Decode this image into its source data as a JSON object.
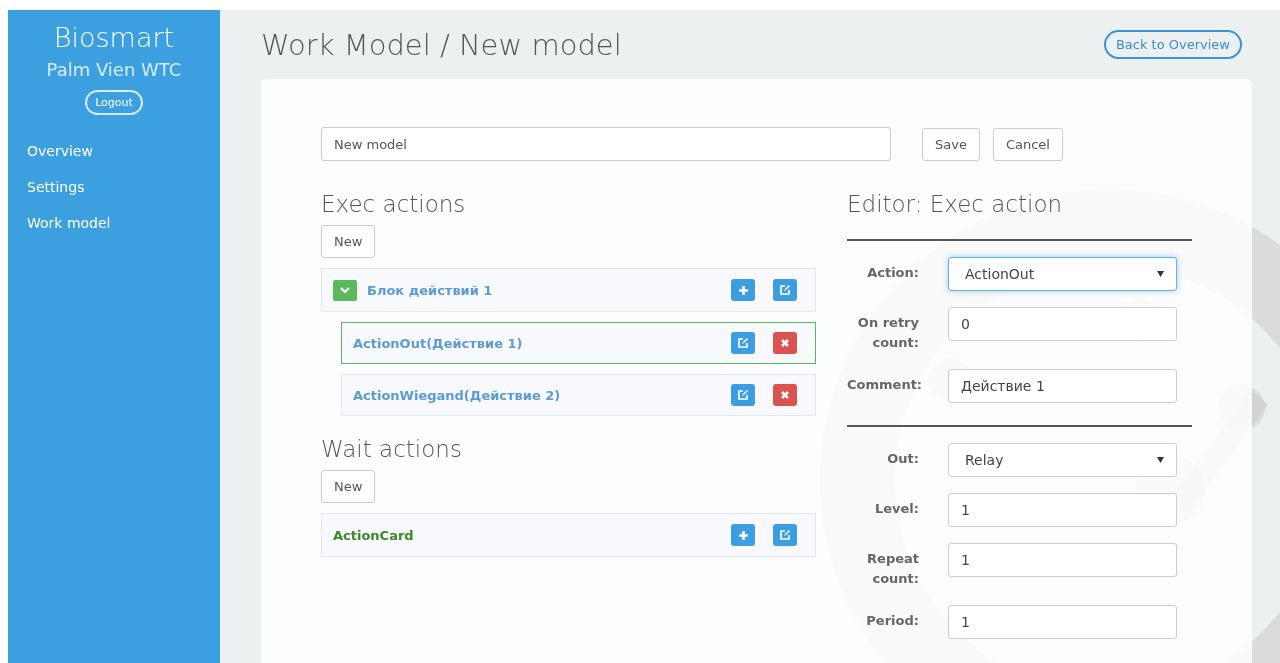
{
  "sidebar": {
    "brand": "Biosmart",
    "site": "Palm Vien WTC",
    "logout": "Logout",
    "items": [
      {
        "label": "Overview"
      },
      {
        "label": "Settings"
      },
      {
        "label": "Work model"
      }
    ]
  },
  "header": {
    "title": "Work Model / New model",
    "back": "Back to Overview"
  },
  "model": {
    "name": "New model",
    "buttons": [
      "Save",
      "Cancel"
    ]
  },
  "exec": {
    "title": "Exec actions",
    "new": "New",
    "items": [
      {
        "kind": "group",
        "label": "Блок действий 1",
        "expanded": true,
        "selected": false,
        "actions": [
          {
            "kind": "add"
          },
          {
            "kind": "edit"
          }
        ],
        "children": [
          {
            "kind": "action",
            "label": "ActionOut(Действие 1)",
            "selected": true,
            "actions": [
              {
                "kind": "edit"
              },
              {
                "kind": "delete"
              }
            ]
          },
          {
            "kind": "action",
            "label": "ActionWiegand(Действие 2)",
            "selected": false,
            "actions": [
              {
                "kind": "edit"
              },
              {
                "kind": "delete"
              }
            ]
          }
        ]
      }
    ]
  },
  "wait": {
    "title": "Wait actions",
    "new": "New",
    "items": [
      {
        "kind": "wait",
        "label": "ActionCard",
        "selected": false,
        "actions": [
          {
            "kind": "add"
          },
          {
            "kind": "edit"
          }
        ]
      }
    ]
  },
  "editor": {
    "title": "Editor: Exec action",
    "sections": [
      [
        {
          "kind": "select",
          "label": "Action:",
          "value": "ActionOut",
          "focused": true
        },
        {
          "kind": "input",
          "label": "On retry count:",
          "value": "0",
          "focused": false
        },
        {
          "kind": "input",
          "label": "Comment:",
          "value": "Действие 1",
          "focused": false
        }
      ],
      [
        {
          "kind": "select",
          "label": "Out:",
          "value": "Relay",
          "focused": false
        },
        {
          "kind": "input",
          "label": "Level:",
          "value": "1",
          "focused": false
        },
        {
          "kind": "input",
          "label": "Repeat count:",
          "value": "1",
          "focused": false
        },
        {
          "kind": "input",
          "label": "Period:",
          "value": "1",
          "focused": false
        }
      ]
    ]
  }
}
